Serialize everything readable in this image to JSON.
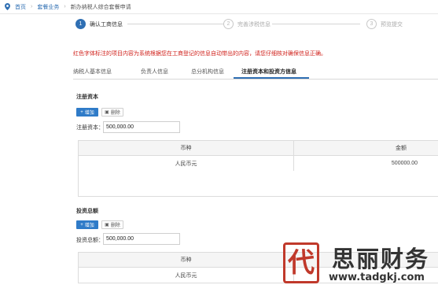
{
  "breadcrumb": {
    "home": "首页",
    "business": "套餐业务",
    "current": "新办纳税人综合套餐申请"
  },
  "steps": [
    {
      "number": "1",
      "label": "确认工商信息"
    },
    {
      "number": "2",
      "label": "完善涉税信息"
    },
    {
      "number": "3",
      "label": "预览提交"
    }
  ],
  "notice": "红色字体标注的项目内容为系统根据您在工商登记的信息自动带出的内容，请您仔细核对确保信息正确。",
  "tabs": [
    {
      "label": "纳税人基本信息"
    },
    {
      "label": "负责人信息"
    },
    {
      "label": "总分机构信息"
    },
    {
      "label": "注册资本和投资方信息"
    }
  ],
  "registered_capital": {
    "title": "注册资本",
    "add_label": "增加",
    "delete_label": "删除",
    "field_label": "注册资本：",
    "field_value": "500,000.00",
    "columns": [
      "币种",
      "金额"
    ],
    "rows": [
      {
        "currency": "人民币元",
        "amount": "500000.00"
      }
    ]
  },
  "total_investment": {
    "title": "投资总额",
    "add_label": "增加",
    "delete_label": "删除",
    "field_label": "投资总额：",
    "field_value": "500,000.00",
    "columns": [
      "币种"
    ],
    "rows": [
      {
        "currency": "人民币元"
      }
    ]
  },
  "watermark": {
    "logo_glyph": "代",
    "name": "思丽财务",
    "url": "www.tadgkj.com"
  },
  "colors": {
    "primary": "#2f6fb3",
    "notice_red": "#d0221c",
    "watermark_red": "#c0392b"
  }
}
